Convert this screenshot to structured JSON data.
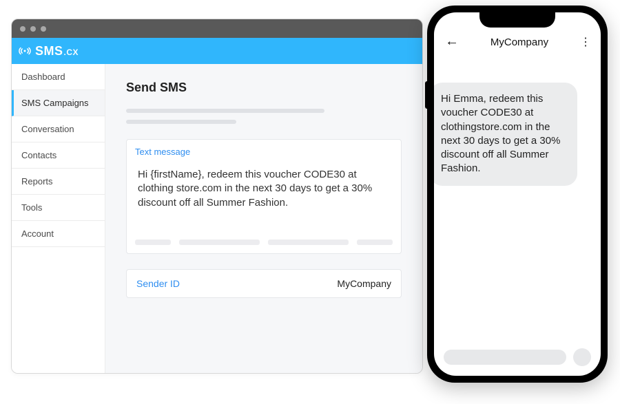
{
  "brand": {
    "name": "SMS",
    "suffix": ".CX"
  },
  "sidebar": {
    "items": [
      {
        "label": "Dashboard"
      },
      {
        "label": "SMS Campaigns"
      },
      {
        "label": "Conversation"
      },
      {
        "label": "Contacts"
      },
      {
        "label": "Reports"
      },
      {
        "label": "Tools"
      },
      {
        "label": "Account"
      }
    ],
    "activeIndex": 1
  },
  "page": {
    "title": "Send SMS",
    "textCard": {
      "label": "Text message",
      "body": "Hi {firstName}, redeem this voucher CODE30 at clothing store.com in the next 30 days to get a 30% discount off all Summer Fashion."
    },
    "senderRow": {
      "label": "Sender ID",
      "value": "MyCompany"
    }
  },
  "phone": {
    "header": {
      "title": "MyCompany"
    },
    "message": "Hi Emma, redeem this voucher CODE30 at clothingstore.com in the next 30 days to get a 30% discount off all Summer Fashion."
  }
}
